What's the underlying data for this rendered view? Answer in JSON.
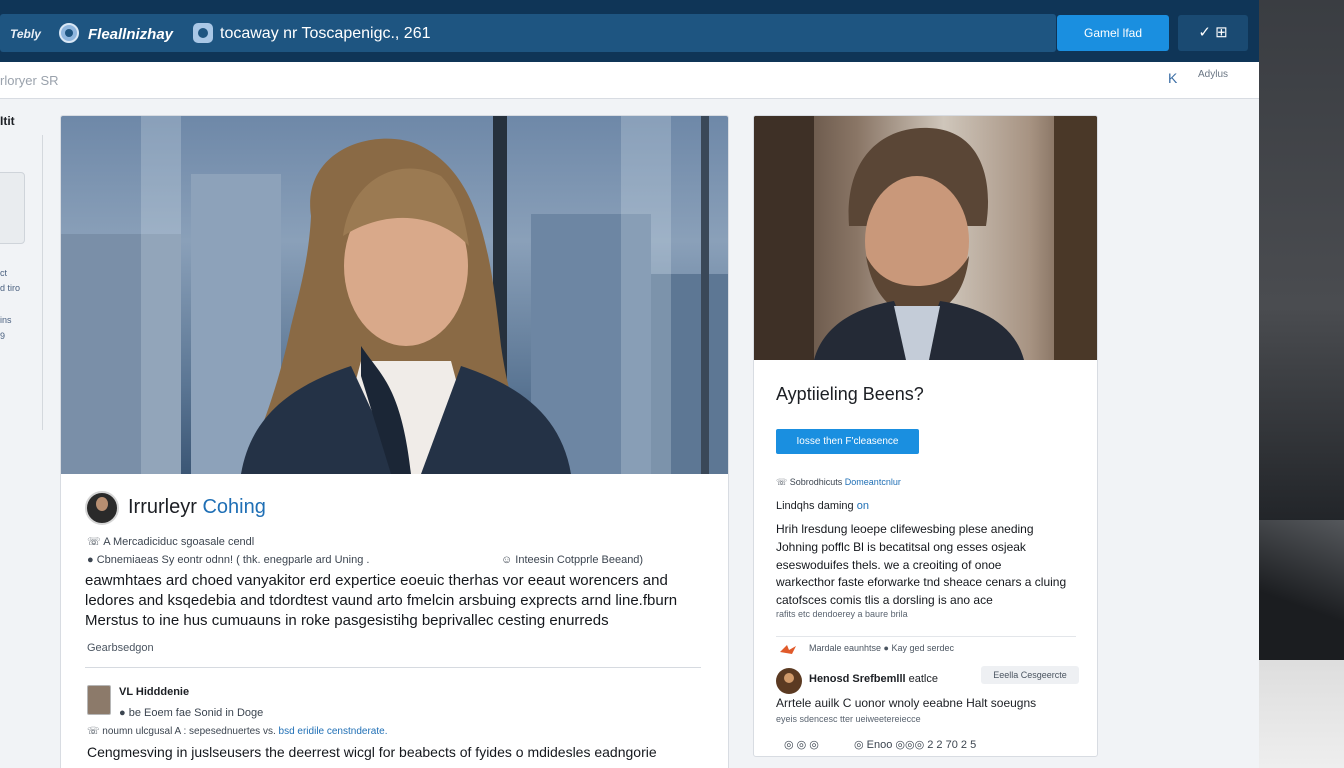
{
  "header": {
    "brand_small": "Tebly",
    "brand_name": "Fleallnizhay",
    "search_text": "tocaway nr Toscapenigc., 261",
    "action_button": "Gamel lfad",
    "menu_glyph": "✓ ⊞"
  },
  "subheader": {
    "left_text": "rloryer SR",
    "right_icon": "K",
    "right_text": "Adylus"
  },
  "sidebar": {
    "title": "Itit",
    "items": [
      "ct",
      "d tiro",
      "ins",
      "9"
    ]
  },
  "post": {
    "title_part1": "Irrurleyr ",
    "title_part2": "Cohing",
    "meta_line_1": "☏ A Mercadiciduc sgoasale cendl",
    "meta_line_2": "● Cbnemiaeas Sy eontr odnn! ( thk. enegparle ard Uning .",
    "meta_line_2_right": "☺ Inteesin Cotpprle Beeand)",
    "body_lines": [
      "eawmhtaes ard choed vanyakitor erd expertice eoeuic therhas vor eeaut worencers and",
      "ledores and ksqedebia and tdordtest vaund arto fmelcin arsbuing exprects arnd line.fburn",
      "Merstus to ine hus cumuauns in roke pasgesistihg beprivallec cesting enurreds"
    ],
    "tag_line": "Gearbsedgon",
    "comment": {
      "name": "VL Hidddenie",
      "sub": "● be Eoem fae Sonid in Doge",
      "meta_prefix": "☏ noumn ulcgusal A : sepesednuertes vs.",
      "meta_link": "bsd eridile censtnderate.",
      "body": "Cengmesving in juslseusers the deerrest wicgl for beabects of fyides o mdidesles eadngorie"
    }
  },
  "side_card": {
    "title": "Ayptiieling Beens?",
    "button": "Iosse then F'cleasence",
    "tag_prefix": "☏ Sobrodhicuts ",
    "tag_link": "Domeantcnlur",
    "subtitle_prefix": "Lindqhs daming ",
    "subtitle_link": "on",
    "lines": [
      "Hrih lresdung leoepe clifewesbing plese aneding",
      "Johning pofflc Bl is becatitsal ong esses osjeak",
      "eseswoduifes thels. we a creoiting of onoe",
      "warkecthor faste eforwarke tnd sheace cenars a cluing",
      "catofsces comis tlis a dorsling is ano ace"
    ],
    "note": "rafits etc dendoerey a baure brila",
    "related_text": "Mardale eaunhtse ● Kay ged serdec",
    "reviewer_name": "Henosd Srefbemlll",
    "reviewer_role": " eatlce",
    "reviewer_button": "Eeella Cesgeercte",
    "review_body": "Arrtele auilk C uonor wnoly eeabne Halt soeugns",
    "review_sub": "eyeis sdencesc tter ueiweetereiecce",
    "footer_left": "◎ ◎ ◎",
    "footer_right": "◎ Enoo ◎◎◎ 2 2 70 2 5"
  }
}
